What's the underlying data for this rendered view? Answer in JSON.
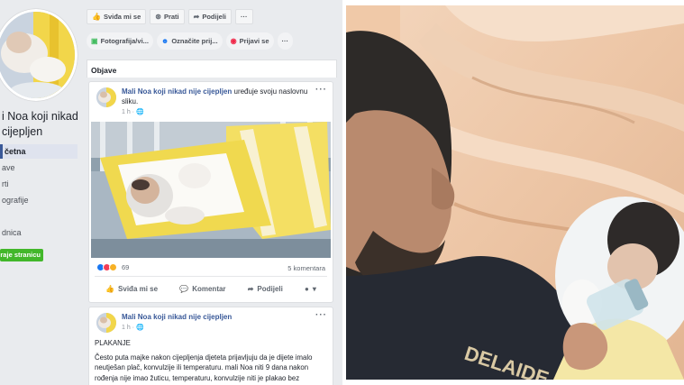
{
  "page": {
    "name": "Mali Noa koji nikad nije cijepljen",
    "name_line1": "i Noa koji nikad",
    "name_line2": "cijepljen",
    "nav": [
      "četna",
      "ave",
      "rti",
      "ografije",
      "",
      "dnica"
    ],
    "promote_label": "raje stranicu"
  },
  "top_actions": [
    {
      "icon": "thumbs-up-icon",
      "label": "Sviđa mi se"
    },
    {
      "icon": "rss-icon",
      "label": "Prati"
    },
    {
      "icon": "share-icon",
      "label": "Podijeli"
    },
    {
      "icon": "more-icon",
      "label": "···"
    }
  ],
  "composer_actions": [
    {
      "icon": "photo-icon",
      "label": "Fotografija/vi..."
    },
    {
      "icon": "tag-people-icon",
      "label": "Označite prij..."
    },
    {
      "icon": "location-pin-icon",
      "label": "Prijavi se"
    },
    {
      "icon": "more-icon",
      "label": "···"
    }
  ],
  "feed": {
    "section_title": "Objave"
  },
  "post1": {
    "author": "Mali Noa koji nikad nije cijepljen",
    "action_text": " uređuje svoju naslovnu sliku.",
    "time": "1 h · ",
    "more": "···",
    "reaction_count": "69",
    "comments": "5 komentara",
    "actions": [
      "Sviđa mi se",
      "Komentar",
      "Podijeli"
    ]
  },
  "post2": {
    "author": "Mali Noa koji nikad nije cijepljen",
    "time": "1 h · ",
    "more": "···",
    "title": "PLAKANJE",
    "body": "Često puta majke nakon cijepljenja djeteta prijavljuju da je dijete imalo neutješan plač, konvulzije ili temperaturu. mali Noa niti 9 dana nakon rođenja nije imao žuticu, temperaturu, konvulzije niti je plakao bez"
  },
  "colors": {
    "fb_bg": "#e9ebee",
    "fb_link": "#385898",
    "fb_green": "#42b72a",
    "like_blue": "#1877f2",
    "love_red": "#f33e58",
    "haha_yellow": "#f7b125"
  }
}
